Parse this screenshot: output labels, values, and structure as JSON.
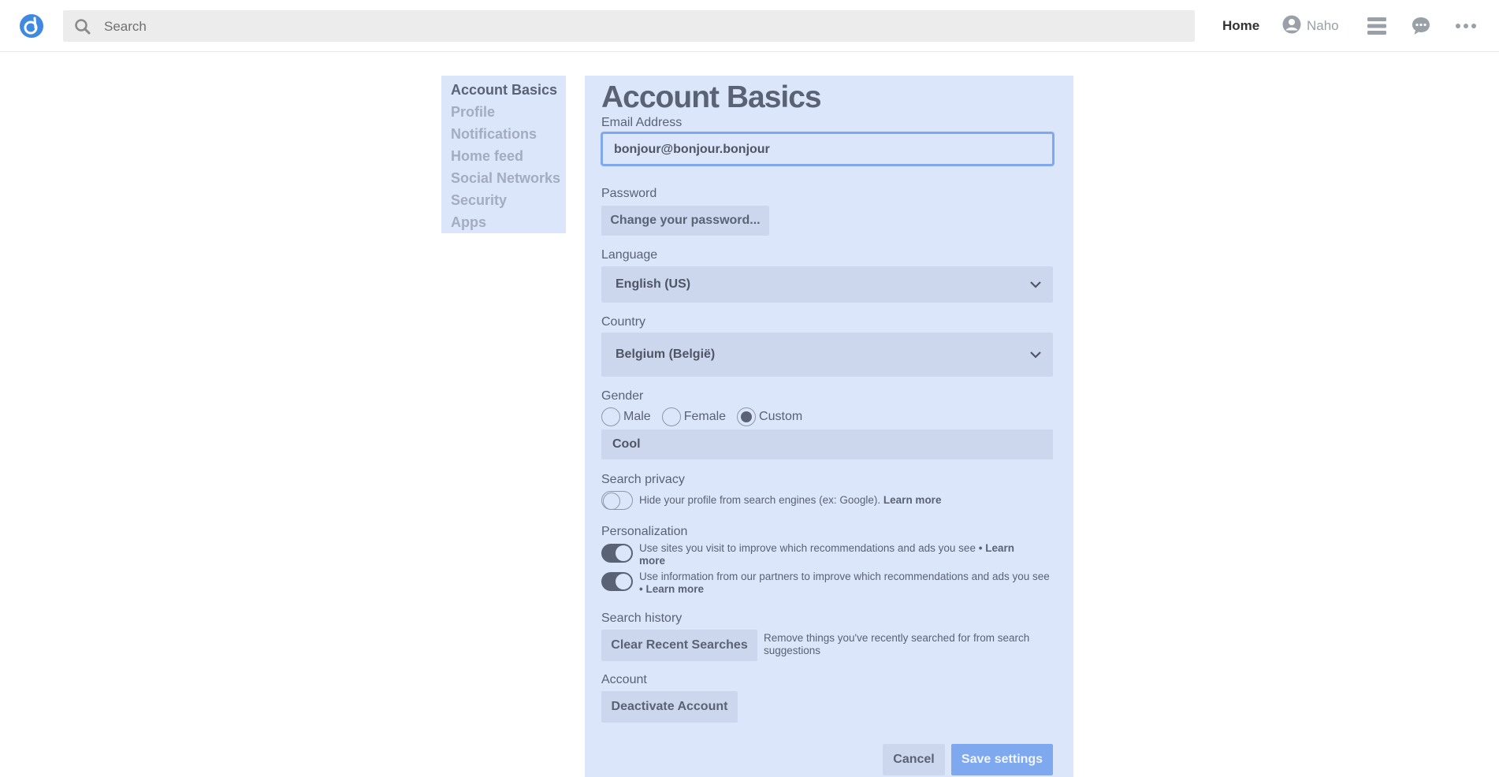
{
  "topbar": {
    "search_placeholder": "Search",
    "home_label": "Home",
    "user_name": "Naho",
    "icons": [
      "diaspora-logo-icon",
      "search-icon",
      "user-avatar-icon",
      "stream-menu-icon",
      "chat-bubble-icon",
      "more-dots-icon"
    ]
  },
  "sidebar": {
    "items": [
      {
        "label": "Account Basics",
        "active": true
      },
      {
        "label": "Profile"
      },
      {
        "label": "Notifications"
      },
      {
        "label": "Home feed"
      },
      {
        "label": "Social Networks"
      },
      {
        "label": "Security"
      },
      {
        "label": "Apps"
      }
    ]
  },
  "main": {
    "title": "Account Basics",
    "email": {
      "label": "Email Address",
      "value": "bonjour@bonjour.bonjour"
    },
    "password": {
      "label": "Password",
      "button": "Change your password..."
    },
    "language": {
      "label": "Language",
      "value": "English (US)"
    },
    "country": {
      "label": "Country",
      "value": "Belgium (België)"
    },
    "gender": {
      "label": "Gender",
      "options": [
        "Male",
        "Female",
        "Custom"
      ],
      "selected": "Custom",
      "custom_value": "Cool"
    },
    "search_privacy": {
      "label": "Search privacy",
      "text": "Hide your profile from search engines (ex: Google).",
      "link": "Learn more",
      "enabled": false
    },
    "personalization": {
      "label": "Personalization",
      "items": [
        {
          "text": "Use sites you visit to improve which recommendations and ads you see",
          "link": "• Learn more",
          "enabled": true
        },
        {
          "text": "Use information from our partners to improve which recommendations and ads you see",
          "link": "• Learn more",
          "enabled": true
        }
      ]
    },
    "search_history": {
      "label": "Search history",
      "button": "Clear Recent Searches",
      "text": "Remove things you've recently searched for from search suggestions"
    },
    "account": {
      "label": "Account",
      "button": "Deactivate Account"
    },
    "actions": {
      "cancel": "Cancel",
      "save": "Save settings"
    },
    "colors": {
      "panel": "#dbe6fb",
      "accent": "#7fa9ef",
      "text": "#5a6275"
    }
  }
}
